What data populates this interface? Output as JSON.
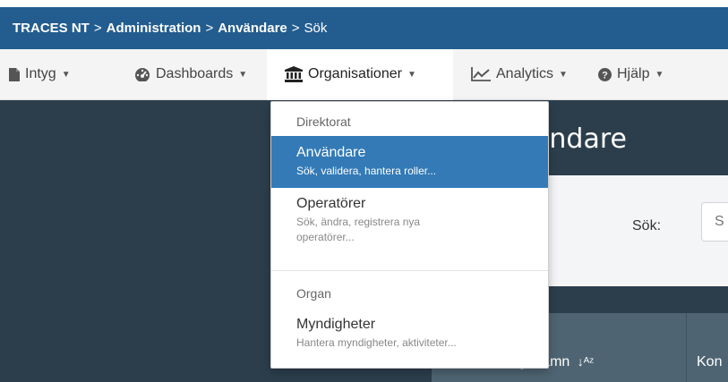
{
  "breadcrumb": {
    "app": "TRACES NT",
    "sep": ">",
    "items": [
      "Administration",
      "Användare",
      "Sök"
    ]
  },
  "nav": {
    "items": [
      {
        "label": "Intyg",
        "icon": "file-icon"
      },
      {
        "label": "Dashboards",
        "icon": "dashboard-icon"
      },
      {
        "label": "Organisationer",
        "icon": "institution-icon"
      },
      {
        "label": "Analytics",
        "icon": "line-chart-icon"
      },
      {
        "label": "Hjälp",
        "icon": "question-circle-icon"
      }
    ],
    "active": "Organisationer"
  },
  "dropdown": {
    "sections": [
      {
        "header": "Direktorat",
        "items": [
          {
            "title": "Användare",
            "desc": "Sök, validera, hantera roller..."
          },
          {
            "title": "Operatörer",
            "desc": "Sök, ändra, registrera nya operatörer..."
          }
        ]
      },
      {
        "header": "Organ",
        "items": [
          {
            "title": "Myndigheter",
            "desc": "Hantera myndigheter, aktiviteter..."
          }
        ]
      }
    ]
  },
  "page": {
    "title": "ändare"
  },
  "search": {
    "label": "Sök:",
    "placeholder": "S"
  },
  "table": {
    "columns": [
      "Fullständigt namn",
      "Kon"
    ]
  },
  "colors": {
    "breadcrumb_bg": "#235d8f",
    "selected_bg": "#337ab7",
    "dark_bg": "#2c3e4c"
  }
}
